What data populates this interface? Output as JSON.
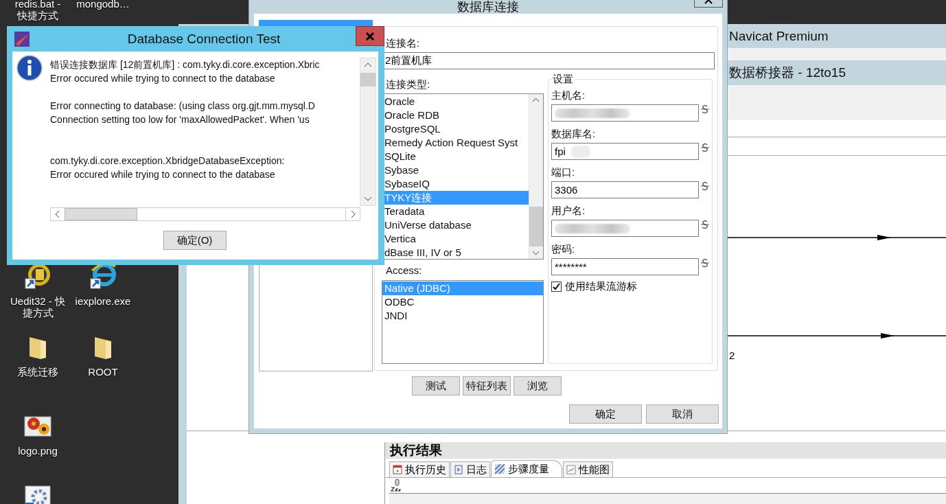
{
  "desktop": {
    "icons": [
      {
        "label": "redis.bat -\n快捷方式"
      },
      {
        "label": "mongodb…"
      },
      {
        "kind": "editor-shortcut",
        "label": "Uedit32 - 快捷方式"
      },
      {
        "kind": "browser-shortcut",
        "label": "iexplore.exe"
      },
      {
        "kind": "folder",
        "label": "系统迁移"
      },
      {
        "kind": "folder",
        "label": "ROOT"
      },
      {
        "kind": "image",
        "label": "logo.png"
      },
      {
        "kind": "settings-shortcut"
      }
    ]
  },
  "navicat": {
    "title": "Navicat Premium",
    "subtitle": "数据桥接器 - 12to15",
    "step_label": "2",
    "results": {
      "title": "执行结果",
      "tabs": [
        {
          "kind": "history",
          "label": "执行历史",
          "selected": false
        },
        {
          "kind": "log",
          "label": "日志",
          "selected": false
        },
        {
          "kind": "metrics",
          "label": "步骤度量",
          "selected": true
        },
        {
          "kind": "chart",
          "label": "性能图",
          "selected": false
        }
      ]
    }
  },
  "connection_dialog": {
    "title": "数据库连接",
    "name_label": "连接名:",
    "name_value": "2前置机库",
    "type_label": "连接类型:",
    "types": [
      {
        "label": "Oracle",
        "selected": false
      },
      {
        "label": "Oracle RDB",
        "selected": false
      },
      {
        "label": "PostgreSQL",
        "selected": false
      },
      {
        "label": "Remedy Action Request Syst",
        "selected": false
      },
      {
        "label": "SQLite",
        "selected": false
      },
      {
        "label": "Sybase",
        "selected": false
      },
      {
        "label": "SybaseIQ",
        "selected": false
      },
      {
        "label": "TYKY连接",
        "selected": true
      },
      {
        "label": "Teradata",
        "selected": false
      },
      {
        "label": "UniVerse database",
        "selected": false
      },
      {
        "label": "Vertica",
        "selected": false
      },
      {
        "label": "dBase III, IV or 5",
        "selected": false
      }
    ],
    "access_label": "Access:",
    "access": [
      {
        "label": "Native (JDBC)",
        "selected": true
      },
      {
        "label": "ODBC",
        "selected": false
      },
      {
        "label": "JNDI",
        "selected": false
      }
    ],
    "settings": {
      "title": "设置",
      "fields": [
        {
          "label": "主机名:",
          "redacted": true
        },
        {
          "label": "数据库名:",
          "value": "fpi",
          "redacted": true
        },
        {
          "label": "端口:",
          "value": "3306",
          "redacted": false
        },
        {
          "label": "用户名:",
          "redacted": true
        },
        {
          "label": "密码:",
          "value": "********",
          "redacted": false
        }
      ],
      "option": {
        "label": "使用结果流游标",
        "checked": true
      }
    },
    "buttons": [
      "测试",
      "特征列表",
      "浏览"
    ],
    "dialog_buttons": [
      "确定",
      "取消"
    ]
  },
  "test_dialog": {
    "title": "Database Connection Test",
    "message": "错误连接数据库 [12前置机库] : com.tyky.di.core.exception.Xbric\nError occured while trying to connect to the database\n\nError connecting to database: (using class org.gjt.mm.mysql.D\nConnection setting too low for 'maxAllowedPacket'. When 'us\n\n\ncom.tyky.di.core.exception.XbridgeDatabaseException:\nError occured while trying to connect to the database",
    "button": "确定(O)"
  }
}
